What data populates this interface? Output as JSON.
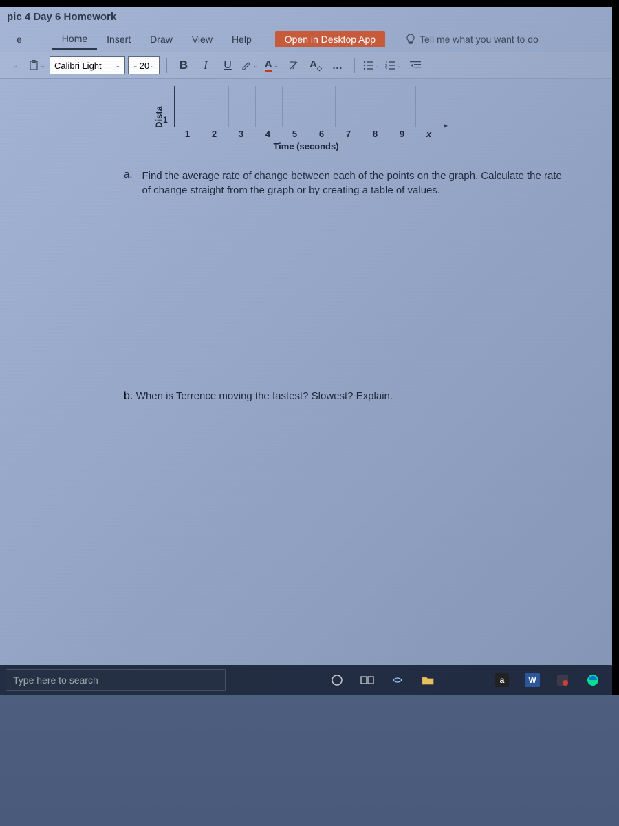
{
  "title_bar": "pic 4 Day 6 Homework",
  "tabs": {
    "file_letter": "e",
    "home": "Home",
    "insert": "Insert",
    "draw": "Draw",
    "view": "View",
    "help": "Help"
  },
  "open_desktop": "Open in Desktop App",
  "tell_me": "Tell me what you want to do",
  "toolbar": {
    "font": "Calibri Light",
    "size": "20",
    "bold": "B",
    "italic": "I",
    "underline": "U",
    "more": "..."
  },
  "chart_data": {
    "type": "line",
    "xlabel": "Time (seconds)",
    "ylabel": "Dista",
    "x_ticks": [
      "1",
      "2",
      "3",
      "4",
      "5",
      "6",
      "7",
      "8",
      "9",
      "x"
    ],
    "y_ticks": [
      "1"
    ],
    "xlim": [
      0,
      10
    ],
    "ylim_visible": [
      0,
      2
    ],
    "note": "Only bottom strip of a distance-vs-time grid is visible; data points are cut off above the view."
  },
  "question_a": {
    "label": "a.",
    "text": "Find the average rate of change between each of the points on the graph. Calculate the rate of change straight from the graph or by creating a table of values."
  },
  "question_b": {
    "label": "b.",
    "text": "When is Terrence moving the fastest? Slowest? Explain."
  },
  "taskbar": {
    "search_placeholder": "Type here to search"
  },
  "colors": {
    "accent_orange": "#c85a3a",
    "ink": "#1a2a3a"
  }
}
